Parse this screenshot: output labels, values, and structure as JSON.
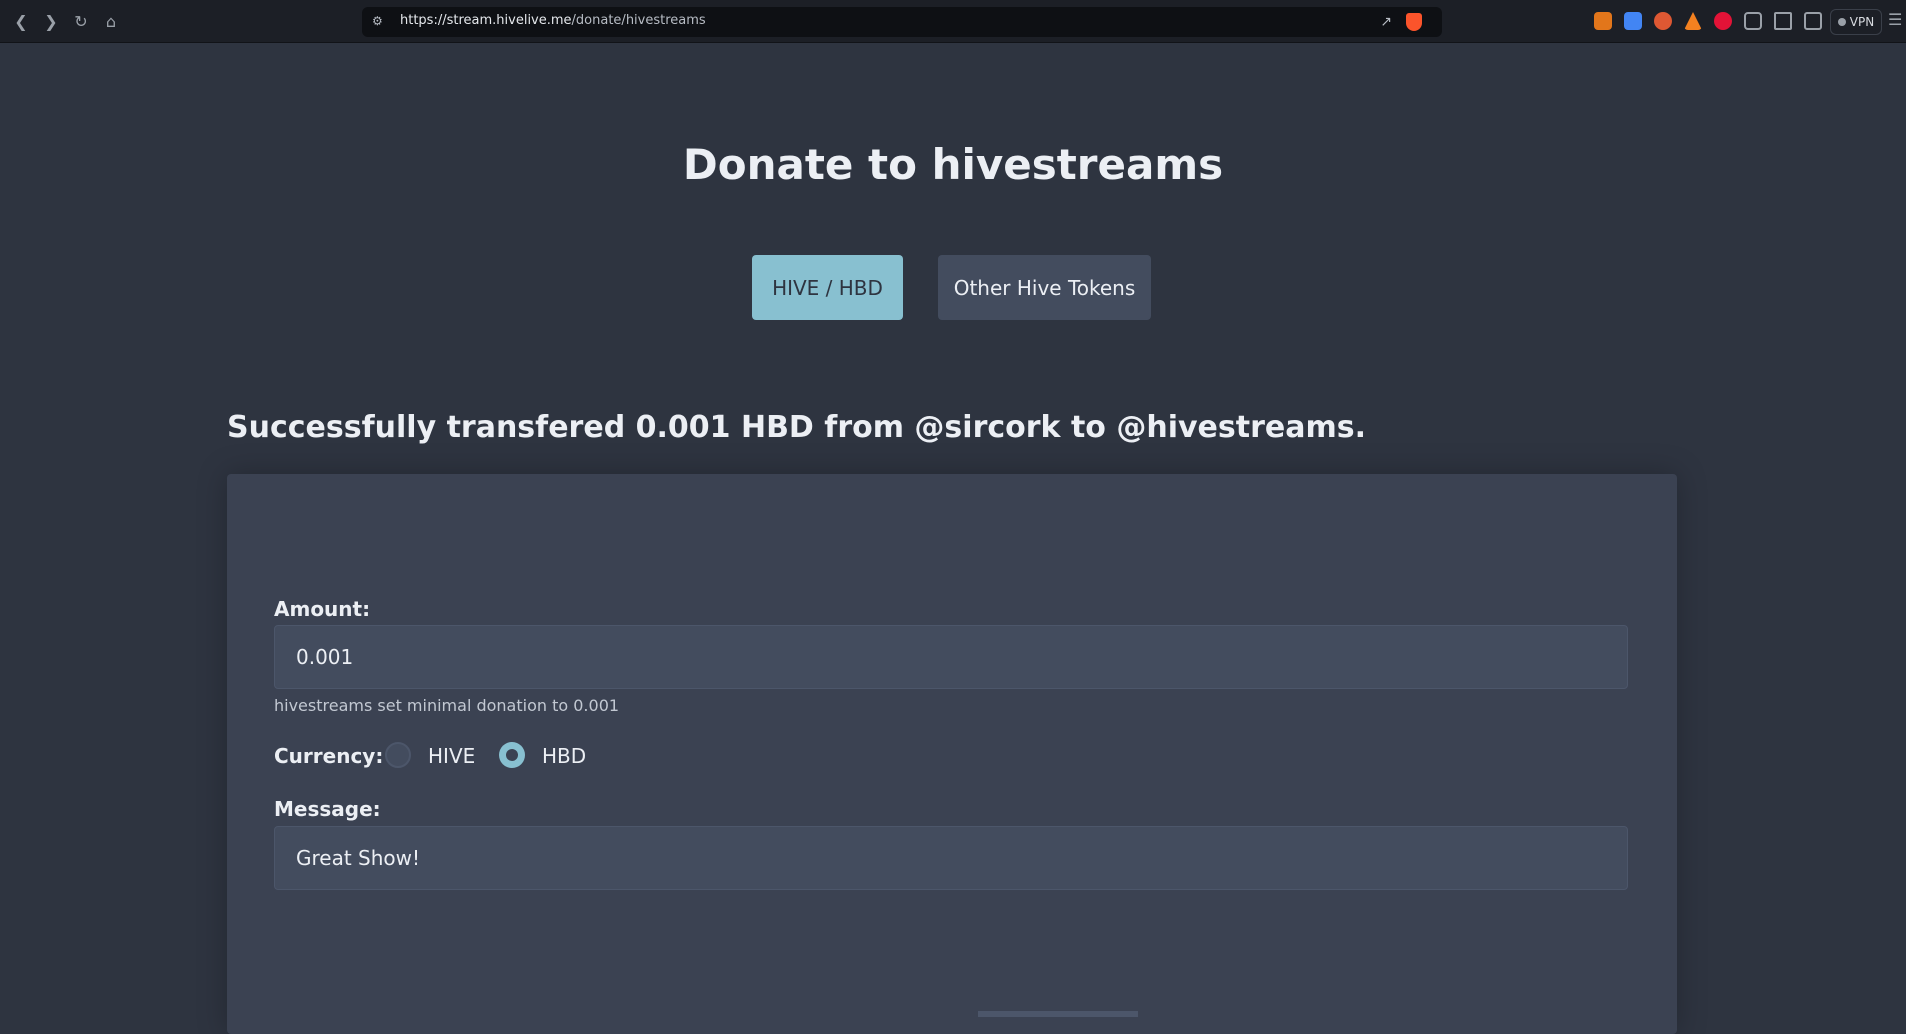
{
  "browser": {
    "url_host": "https://stream.hivelive.me",
    "url_path": "/donate/hivestreams",
    "vpn_label": "VPN"
  },
  "page": {
    "title": "Donate to hivestreams",
    "tabs": [
      {
        "label": "HIVE / HBD",
        "active": true
      },
      {
        "label": "Other Hive Tokens",
        "active": false
      }
    ],
    "success_message": "Successfully transfered 0.001 HBD from @sircork to @hivestreams."
  },
  "form": {
    "amount_label": "Amount:",
    "amount_value": "0.001",
    "min_note": "hivestreams set minimal donation to 0.001",
    "currency_label": "Currency:",
    "currency_options": [
      {
        "label": "HIVE",
        "selected": false
      },
      {
        "label": "HBD",
        "selected": true
      }
    ],
    "message_label": "Message:",
    "message_value": "Great Show!"
  },
  "colors": {
    "background": "#2e3440",
    "card": "#3b4252",
    "accent": "#88c0d0",
    "input": "#434c5e"
  }
}
